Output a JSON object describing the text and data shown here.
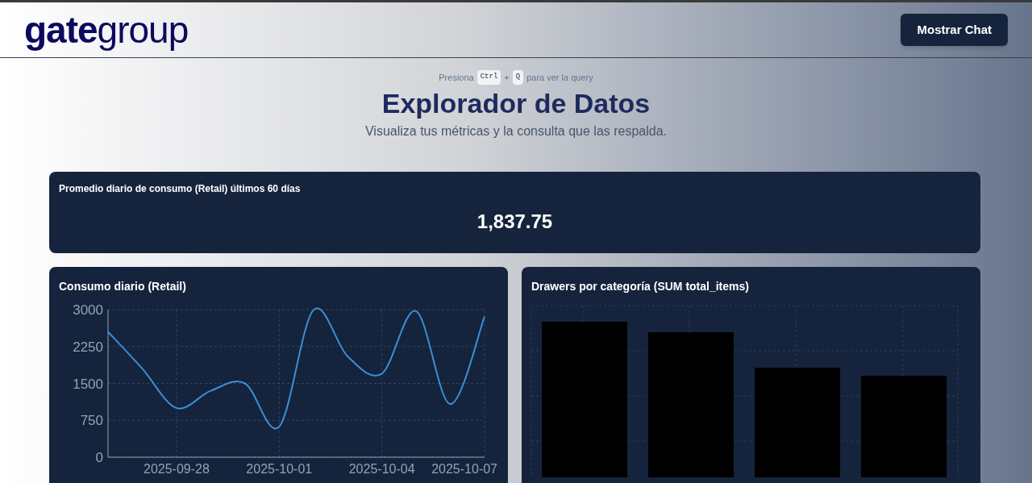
{
  "header": {
    "logo": {
      "bold_part": "gate",
      "light_part": "group"
    },
    "chat_button": "Mostrar Chat"
  },
  "hint": {
    "before": "Presiona",
    "keys": [
      "Ctrl",
      "Q"
    ],
    "joiner": "+",
    "after": "para ver la query"
  },
  "title": "Explorador de Datos",
  "subtitle": "Visualiza tus métricas y la consulta que las respalda.",
  "kpi": {
    "label": "Promedio diario de consumo (Retail) últimos 60 días",
    "value": "1,837.75"
  },
  "line_card": {
    "title": "Consumo diario (Retail)",
    "chart_data": {
      "type": "line",
      "x": [
        "2025-09-26",
        "2025-09-27",
        "2025-09-28",
        "2025-09-29",
        "2025-09-30",
        "2025-10-01",
        "2025-10-02",
        "2025-10-03",
        "2025-10-04",
        "2025-10-05",
        "2025-10-06",
        "2025-10-07"
      ],
      "series": [
        {
          "color": "#3b8fd4",
          "values": [
            2550,
            1800,
            1000,
            1350,
            1500,
            620,
            2990,
            2050,
            1700,
            2970,
            1080,
            2860
          ]
        }
      ],
      "xlim": [
        "2025-09-26",
        "2025-10-07"
      ],
      "grid": true,
      "ylim": [
        0,
        3000
      ],
      "yticks": [
        0,
        750,
        1500,
        2250,
        3000
      ],
      "xticks": [
        "2025-09-28",
        "2025-10-01",
        "2025-10-04",
        "2025-10-07"
      ]
    }
  },
  "bar_card": {
    "title": "Drawers por categoría (SUM total_items)"
  }
}
